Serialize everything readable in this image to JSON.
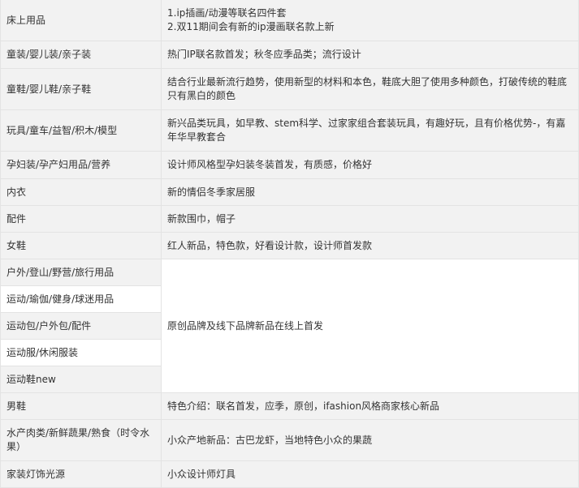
{
  "rows": [
    {
      "category": "床上用品",
      "desc_lines": [
        "1.ip插画/动漫等联名四件套",
        "2.双11期间会有新的ip漫画联名款上新"
      ]
    },
    {
      "category": "童装/婴儿装/亲子装",
      "desc": "热门IP联名款首发；秋冬应季品类；流行设计"
    },
    {
      "category": "童鞋/婴儿鞋/亲子鞋",
      "desc": "结合行业最新流行趋势，使用新型的材料和本色，鞋底大胆了使用多种颜色，打破传统的鞋底只有黑白的颜色"
    },
    {
      "category": "玩具/童车/益智/积木/模型",
      "desc": "新兴品类玩具，如早教、stem科学、过家家组合套装玩具，有趣好玩，且有价格优势-，有嘉年华早教套合"
    },
    {
      "category": "孕妇装/孕产妇用品/营养",
      "desc": "设计师风格型孕妇装冬装首发，有质感，价格好"
    },
    {
      "category": "内衣",
      "desc": "新的情侣冬季家居服"
    },
    {
      "category": "配件",
      "desc": "新款围巾，帽子"
    },
    {
      "category": "女鞋",
      "desc": "红人新品，特色款，好看设计款，设计师首发款"
    }
  ],
  "group": {
    "categories": [
      "户外/登山/野营/旅行用品",
      "运动/瑜伽/健身/球迷用品",
      "运动包/户外包/配件",
      "运动服/休闲服装",
      "运动鞋new"
    ],
    "desc": "原创品牌及线下品牌新品在线上首发"
  },
  "rows_after": [
    {
      "category": "男鞋",
      "desc": "特色介绍：联名首发，应季，原创，ifashion风格商家核心新品"
    },
    {
      "category": "水产肉类/新鲜蔬果/熟食（时令水果）",
      "desc": "小众产地新品：古巴龙虾，当地特色小众的果蔬"
    },
    {
      "category": "家装灯饰光源",
      "desc": "小众设计师灯具"
    }
  ]
}
